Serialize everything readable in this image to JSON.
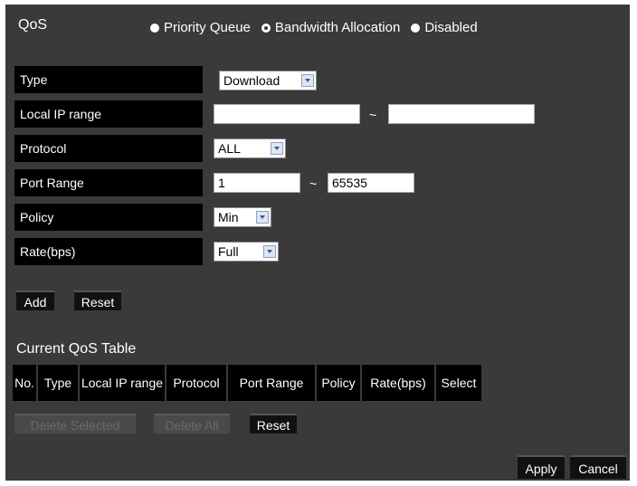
{
  "header": {
    "title": "QoS",
    "modes": [
      {
        "label": "Priority Queue",
        "selected": false
      },
      {
        "label": "Bandwidth Allocation",
        "selected": true
      },
      {
        "label": "Disabled",
        "selected": false
      }
    ]
  },
  "form": {
    "type_label": "Type",
    "type_value": "Download",
    "local_ip_label": "Local IP range",
    "local_ip_start": "",
    "local_ip_end": "",
    "protocol_label": "Protocol",
    "protocol_value": "ALL",
    "port_range_label": "Port Range",
    "port_start": "1",
    "port_end": "65535",
    "policy_label": "Policy",
    "policy_value": "Min",
    "rate_label": "Rate(bps)",
    "rate_value": "Full",
    "tilde": "~"
  },
  "form_buttons": {
    "add": "Add",
    "reset": "Reset"
  },
  "table": {
    "title": "Current QoS Table",
    "columns": [
      "No.",
      "Type",
      "Local IP range",
      "Protocol",
      "Port Range",
      "Policy",
      "Rate(bps)",
      "Select"
    ]
  },
  "table_buttons": {
    "delete_selected": "Delete Selected",
    "delete_all": "Delete All",
    "reset": "Reset"
  },
  "footer": {
    "apply": "Apply",
    "cancel": "Cancel"
  }
}
